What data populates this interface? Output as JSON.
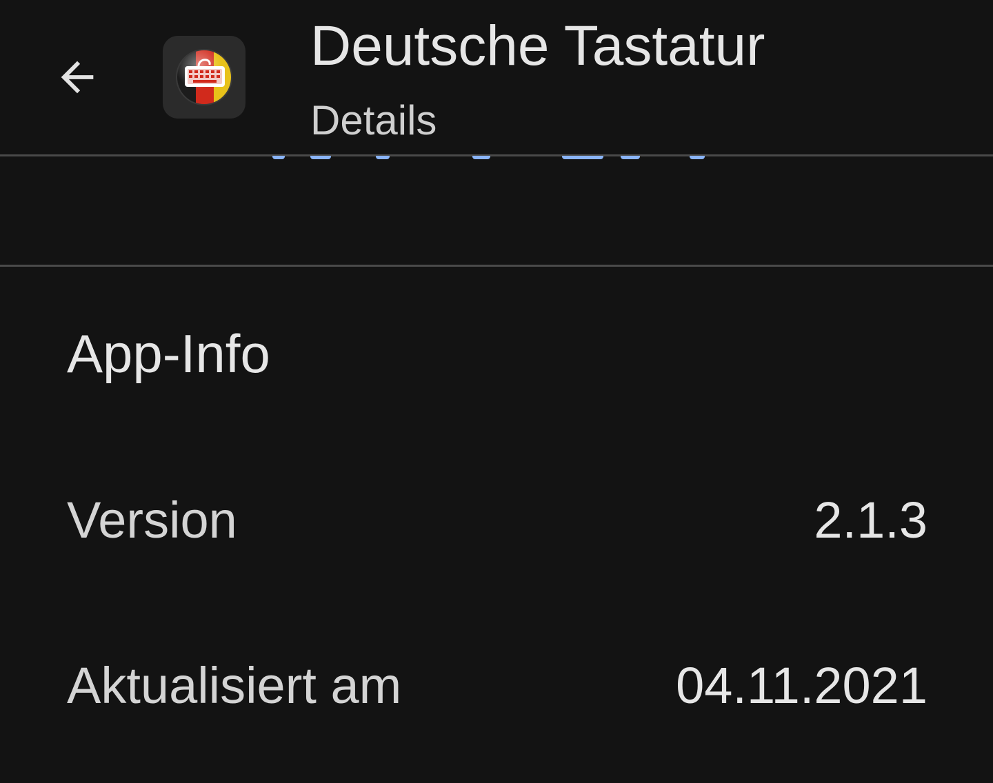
{
  "header": {
    "back_icon": "arrow-back-icon",
    "app_icon": "keyboard-app-icon",
    "title": "Deutsche Tastatur",
    "subtitle": "Details"
  },
  "app_info": {
    "heading": "App-Info",
    "rows": [
      {
        "label": "Version",
        "value": "2.1.3"
      },
      {
        "label": "Aktualisiert am",
        "value": "04.11.2021"
      }
    ]
  },
  "colors": {
    "background": "#131313",
    "text": "#e3e3e3",
    "divider": "#4a4a4a",
    "accent": "#8ab4f8"
  }
}
